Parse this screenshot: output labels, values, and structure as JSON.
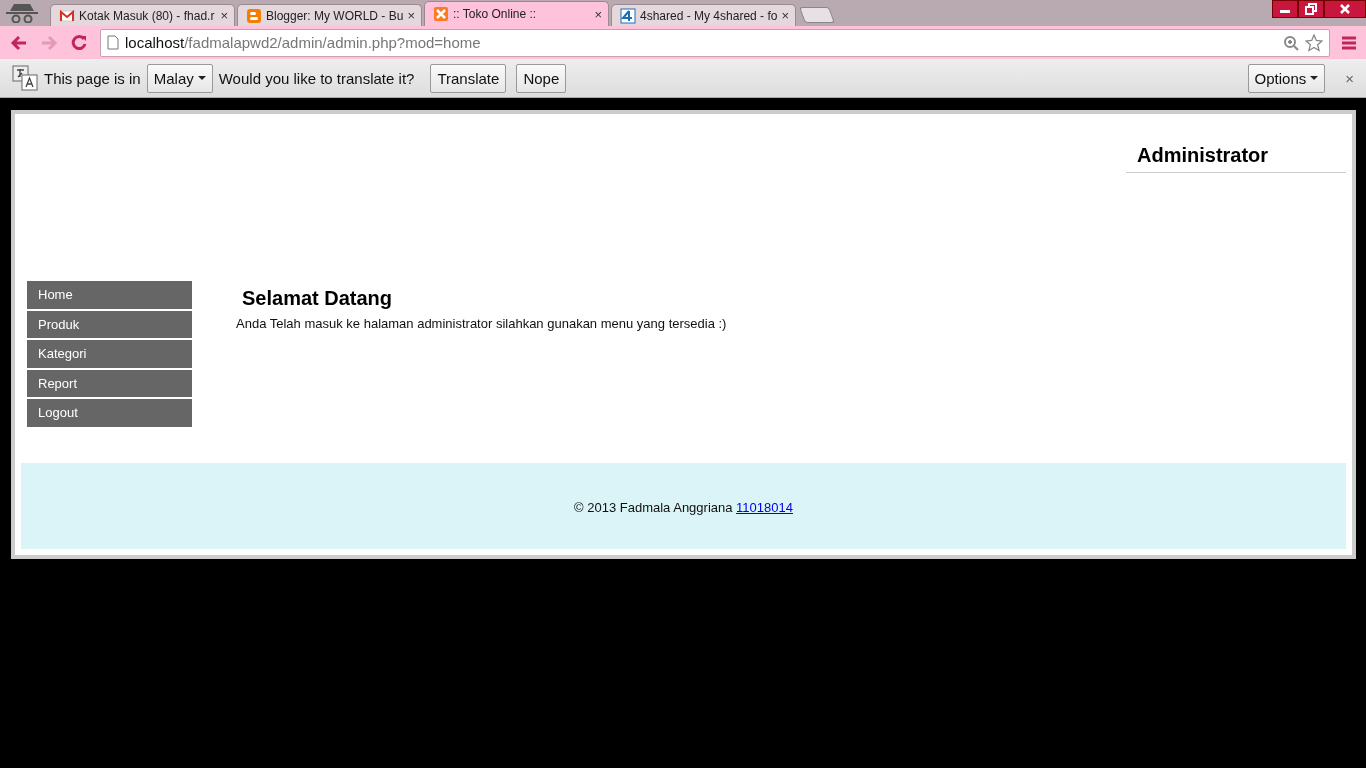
{
  "browser": {
    "tabs": [
      {
        "title": "Kotak Masuk (80) - fhad.r",
        "kind": "mail",
        "close": "×",
        "selected": false
      },
      {
        "title": "Blogger: My WORLD - Bu",
        "kind": "blogger",
        "close": "×",
        "selected": false
      },
      {
        "title": ":: Toko Online ::",
        "kind": "xampp",
        "close": "×",
        "selected": true
      },
      {
        "title": "4shared - My 4shared - fo",
        "kind": "four",
        "close": "×",
        "selected": false
      }
    ],
    "address": {
      "host": "localhost",
      "path": "/fadmalapwd2/admin/admin.php?mod=home"
    }
  },
  "translate_bar": {
    "prefix": "This page is in",
    "language": "Malay",
    "question": "Would you like to translate it?",
    "buttons": [
      "Translate",
      "Nope"
    ],
    "options": "Options",
    "close": "×"
  },
  "page": {
    "header_title": "Administrator",
    "menu": [
      "Home",
      "Produk",
      "Kategori",
      "Report",
      "Logout"
    ],
    "heading": "Selamat Datang",
    "message": "Anda Telah masuk ke halaman administrator silahkan gunakan menu yang tersedia :)",
    "footer": {
      "text": "© 2013 Fadmala Anggriana",
      "link": "11018014"
    }
  }
}
